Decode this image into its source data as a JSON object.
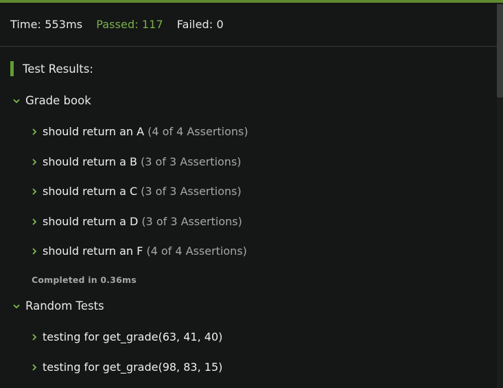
{
  "summary": {
    "time": "Time: 553ms",
    "passed": "Passed: 117",
    "failed": "Failed: 0"
  },
  "results_title": "Test Results:",
  "groups": [
    {
      "title": "Grade book",
      "tests": [
        {
          "label": "should return an A",
          "assertions": "(4 of 4 Assertions)"
        },
        {
          "label": "should return a B",
          "assertions": "(3 of 3 Assertions)"
        },
        {
          "label": "should return a C",
          "assertions": "(3 of 3 Assertions)"
        },
        {
          "label": "should return a D",
          "assertions": "(3 of 3 Assertions)"
        },
        {
          "label": "should return an F",
          "assertions": "(4 of 4 Assertions)"
        }
      ],
      "completed": "Completed in 0.36ms"
    },
    {
      "title": "Random Tests",
      "tests": [
        {
          "label": "testing for get_grade(63, 41, 40)"
        },
        {
          "label": "testing for get_grade(98, 83, 15)"
        }
      ]
    }
  ],
  "colors": {
    "accent": "#5f8b2f",
    "passed": "#78b34a",
    "background": "#151616"
  },
  "icons": {
    "expanded": "chevron-down-icon",
    "collapsed": "chevron-right-icon"
  }
}
